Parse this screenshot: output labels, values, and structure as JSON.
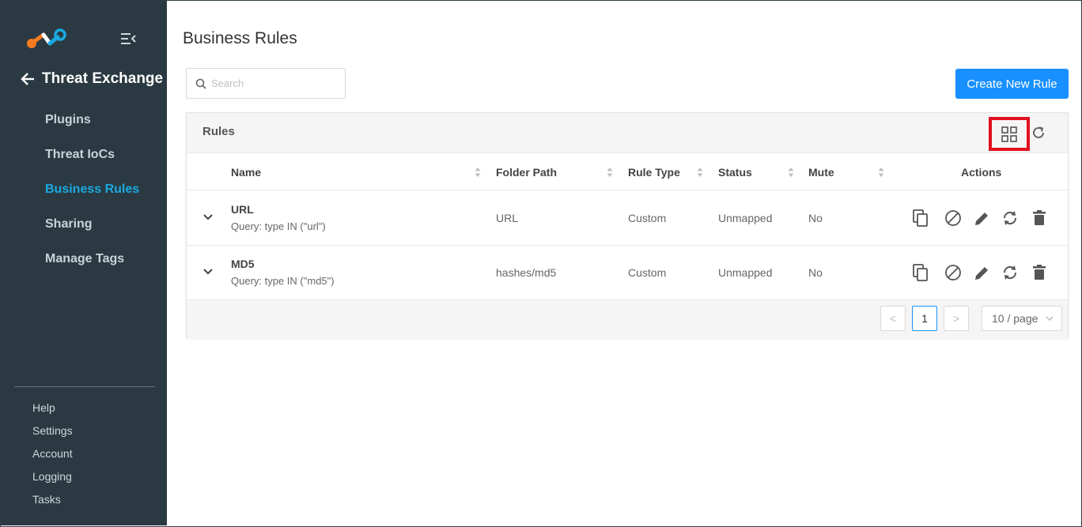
{
  "sidebar": {
    "section_title": "Threat Exchange",
    "items": [
      {
        "label": "Plugins"
      },
      {
        "label": "Threat IoCs"
      },
      {
        "label": "Business Rules"
      },
      {
        "label": "Sharing"
      },
      {
        "label": "Manage Tags"
      }
    ],
    "footer": [
      {
        "label": "Help"
      },
      {
        "label": "Settings"
      },
      {
        "label": "Account"
      },
      {
        "label": "Logging"
      },
      {
        "label": "Tasks"
      }
    ],
    "active_item": "Business Rules"
  },
  "header": {
    "title": "Business Rules",
    "search_placeholder": "Search",
    "create_button": "Create New Rule"
  },
  "card": {
    "title": "Rules",
    "columns": [
      "Name",
      "Folder Path",
      "Rule Type",
      "Status",
      "Mute",
      "Actions"
    ],
    "rows": [
      {
        "name": "URL",
        "query": "Query: type IN (\"url\")",
        "folder_path": "URL",
        "rule_type": "Custom",
        "status": "Unmapped",
        "mute": "No"
      },
      {
        "name": "MD5",
        "query": "Query: type IN (\"md5\")",
        "folder_path": "hashes/md5",
        "rule_type": "Custom",
        "status": "Unmapped",
        "mute": "No"
      }
    ],
    "pagination": {
      "prev": "<",
      "current": "1",
      "next": ">",
      "page_size": "10 / page"
    }
  },
  "colors": {
    "sidebar_bg": "#2b3a42",
    "accent": "#1890ff",
    "active_nav": "#1aa9e1",
    "highlight": "#e10f1f"
  }
}
